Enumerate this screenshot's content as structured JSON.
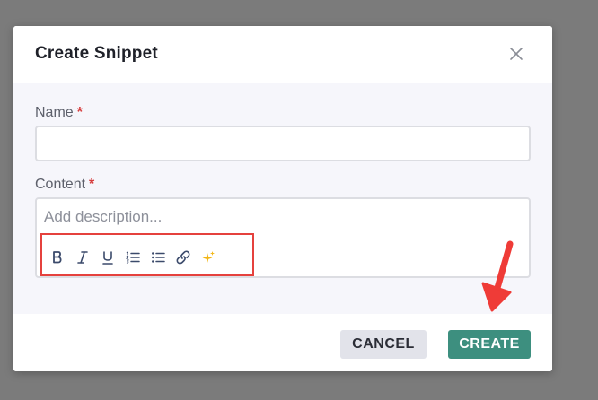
{
  "dialog": {
    "title": "Create Snippet"
  },
  "form": {
    "name_label": "Name",
    "name_required": "*",
    "name_value": "",
    "content_label": "Content",
    "content_required": "*",
    "content_placeholder": "Add description..."
  },
  "toolbar": {
    "buttons": [
      {
        "name": "bold",
        "glyph": "B"
      },
      {
        "name": "italic",
        "glyph": "I"
      },
      {
        "name": "underline",
        "glyph": "U"
      },
      {
        "name": "ordered-list",
        "glyph": ""
      },
      {
        "name": "bullet-list",
        "glyph": ""
      },
      {
        "name": "link",
        "glyph": ""
      },
      {
        "name": "ai-sparkle",
        "glyph": ""
      }
    ]
  },
  "footer": {
    "cancel_label": "CANCEL",
    "create_label": "CREATE"
  },
  "colors": {
    "overlay": "#7b7b7b",
    "accent": "#3d8f7f",
    "highlight": "#e5413d",
    "required": "#d63c3c"
  }
}
